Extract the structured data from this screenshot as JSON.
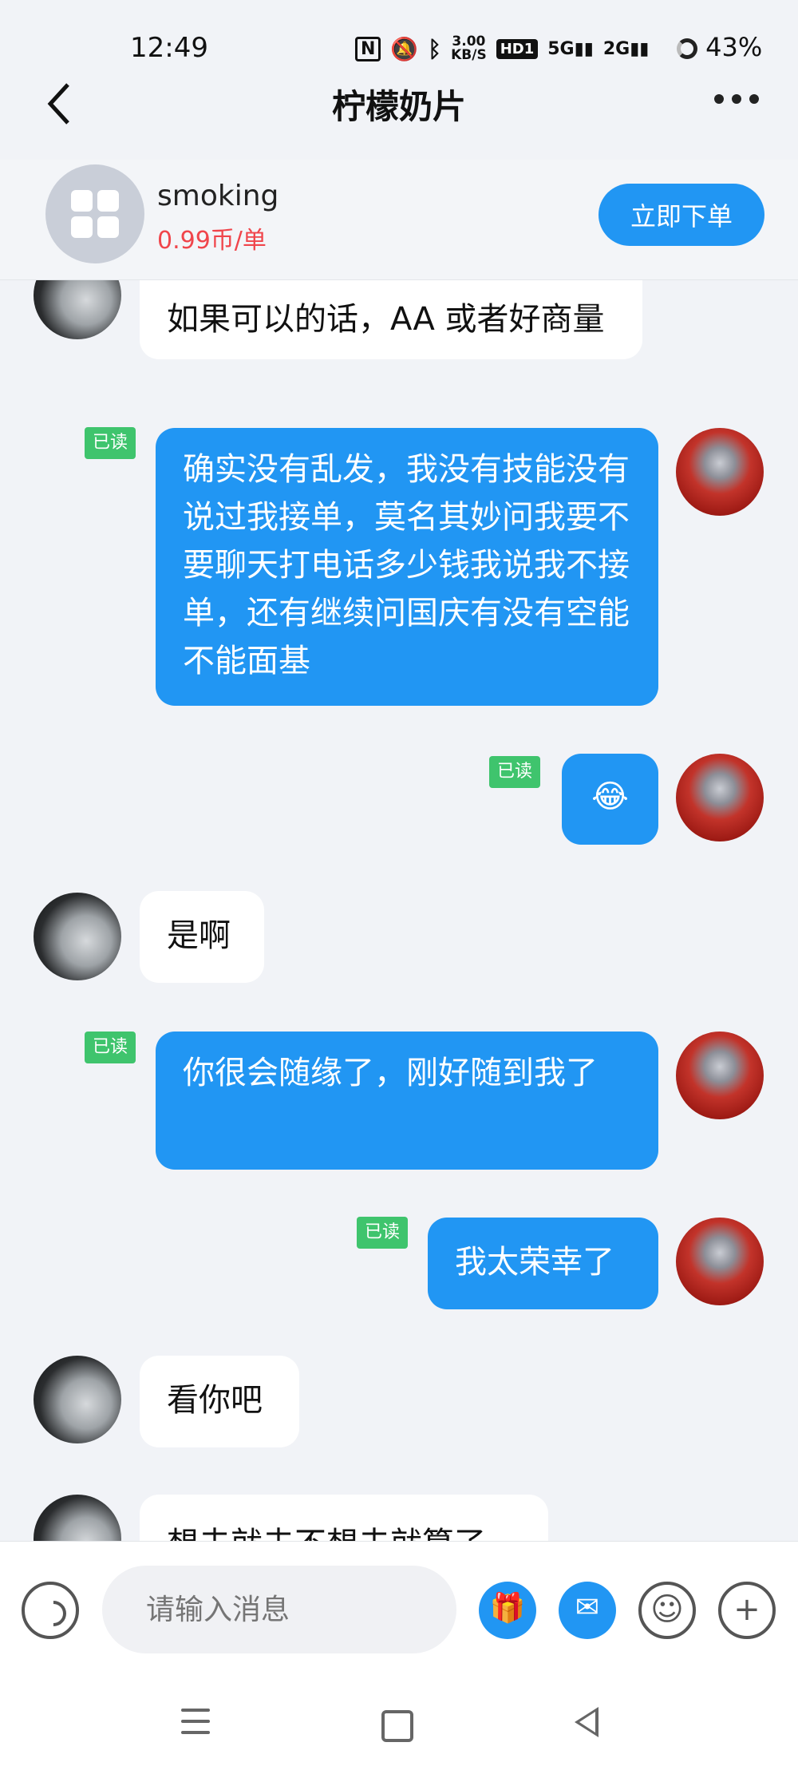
{
  "status_bar": {
    "time": "12:49",
    "speed_value": "3.00",
    "speed_unit": "KB/S",
    "hd_label": "HD1",
    "sig5g": "5G",
    "sig2g": "2G",
    "battery": "43%"
  },
  "header": {
    "title": "柠檬奶片"
  },
  "order": {
    "name": "smoking",
    "price": "0.99币/单",
    "buy_label": "立即下单"
  },
  "messages": [
    {
      "side": "in",
      "text": "如果可以的话，AA 或者好商量"
    },
    {
      "side": "out",
      "read": "已读",
      "text": "确实没有乱发，我没有技能没有说过我接单，莫名其妙问我要不要聊天打电话多少钱我说我不接单，还有继续问国庆有没有空能不能面基"
    },
    {
      "side": "out",
      "read": "已读",
      "text": "😂"
    },
    {
      "side": "in",
      "text": "是啊"
    },
    {
      "side": "out",
      "read": "已读",
      "text": "你很会随缘了，刚好随到我了"
    },
    {
      "side": "out",
      "read": "已读",
      "text": "我太荣幸了"
    },
    {
      "side": "in",
      "text": "看你吧"
    },
    {
      "side": "in",
      "text": "想去就去不想去就算了"
    }
  ],
  "input": {
    "placeholder": "请输入消息"
  },
  "colors": {
    "accent": "#2196f3",
    "read_badge": "#3fc46d",
    "price": "#f0454b",
    "background": "#f1f3f7"
  },
  "icons": [
    "back-icon",
    "more-icon",
    "voice-icon",
    "gift-icon",
    "red-packet-icon",
    "emoji-icon",
    "plus-icon",
    "menu-icon",
    "home-icon",
    "nav-back-icon"
  ]
}
